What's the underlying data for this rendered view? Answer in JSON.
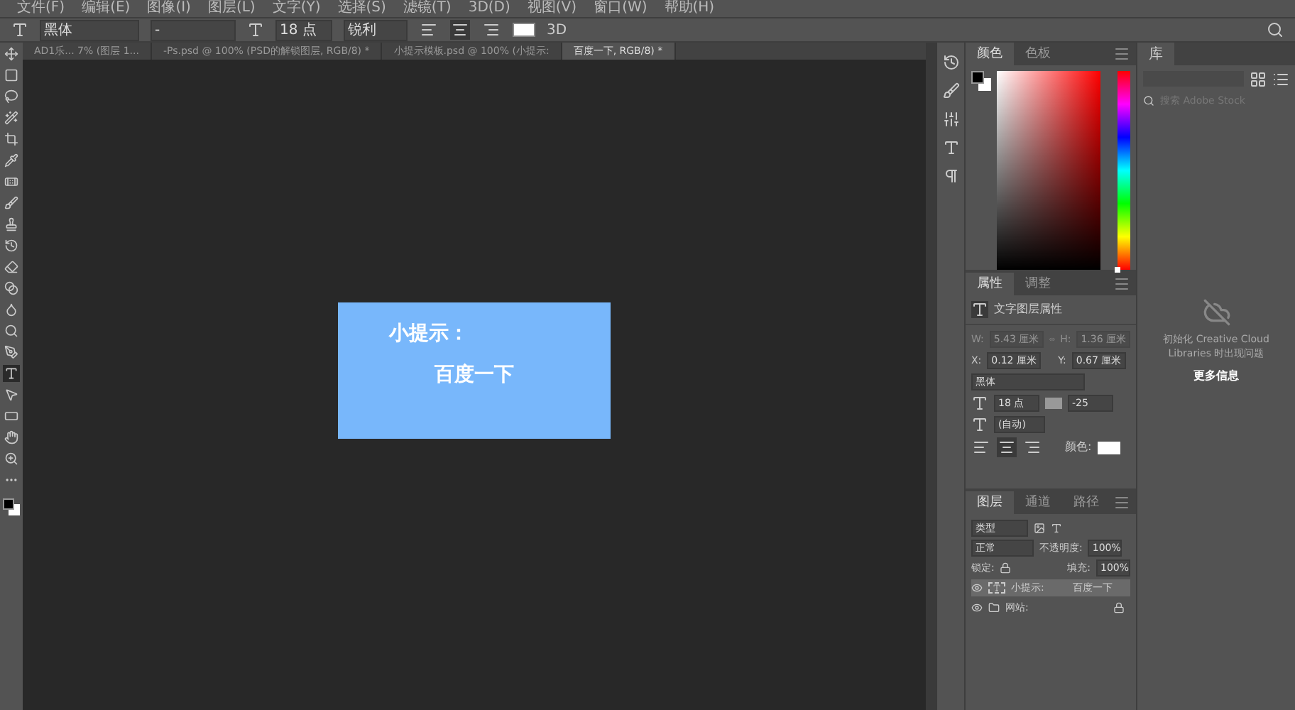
{
  "menu": [
    "文件(F)",
    "编辑(E)",
    "图像(I)",
    "图层(L)",
    "文字(Y)",
    "选择(S)",
    "滤镜(T)",
    "3D(D)",
    "视图(V)",
    "窗口(W)",
    "帮助(H)"
  ],
  "options_bar": {
    "font_family": "黑体",
    "font_style": "-",
    "font_size": "18 点",
    "antialias": "锐利",
    "align": [
      {
        "selected": false
      },
      {
        "selected": true
      },
      {
        "selected": false
      }
    ],
    "threed": "3D"
  },
  "tabs": [
    {
      "label": "AD1乐... 7% (图层 1...",
      "selected": false
    },
    {
      "label": "-Ps.psd @ 100% (PSD的解锁图层, RGB/8) *",
      "selected": false
    },
    {
      "label": "小提示模板.psd @ 100% (小提示:",
      "selected": false
    },
    {
      "label": "百度一下, RGB/8) *",
      "selected": true
    }
  ],
  "tools": [
    {
      "kind": "move",
      "selected": false
    },
    {
      "kind": "marquee",
      "selected": false
    },
    {
      "kind": "lasso",
      "selected": false
    },
    {
      "kind": "wand",
      "selected": false
    },
    {
      "kind": "crop",
      "selected": false
    },
    {
      "kind": "eyedropper",
      "selected": false
    },
    {
      "kind": "heal",
      "selected": false
    },
    {
      "kind": "brush",
      "selected": false
    },
    {
      "kind": "stamp",
      "selected": false
    },
    {
      "kind": "history",
      "selected": false
    },
    {
      "kind": "eraser",
      "selected": false
    },
    {
      "kind": "gradient",
      "selected": false
    },
    {
      "kind": "blur",
      "selected": false
    },
    {
      "kind": "dodge",
      "selected": false
    },
    {
      "kind": "pen",
      "selected": false
    },
    {
      "kind": "type",
      "selected": true
    },
    {
      "kind": "select",
      "selected": false
    },
    {
      "kind": "rectangle",
      "selected": false
    },
    {
      "kind": "hand",
      "selected": false
    },
    {
      "kind": "zoom",
      "selected": false
    },
    {
      "kind": "more",
      "selected": false
    }
  ],
  "canvas": {
    "title": "小提示：",
    "text": "百度一下"
  },
  "color_panel": {
    "hue_slider": {
      "level": 0
    },
    "tabs": [
      {
        "label": "颜色",
        "selected": true
      },
      {
        "label": "色板",
        "selected": false
      }
    ]
  },
  "properties": {
    "tabs": [
      {
        "label": "属性",
        "selected": true
      },
      {
        "label": "调整",
        "selected": false
      }
    ],
    "header": "文字图层属性",
    "w_label": "W:",
    "w": "5.43 厘米",
    "h_label": "H:",
    "h": "1.36 厘米",
    "x_label": "X:",
    "x": "0.12 厘米",
    "y_label": "Y:",
    "y": "0.67 厘米",
    "font": "黑体",
    "size": "18 点",
    "tracking": "-25",
    "leading": "(自动)",
    "align": [
      {
        "selected": false
      },
      {
        "selected": true
      },
      {
        "selected": false
      }
    ],
    "color_label": "颜色:"
  },
  "layers": {
    "tabs": [
      {
        "label": "图层",
        "selected": true
      },
      {
        "label": "通道",
        "selected": false
      },
      {
        "label": "路径",
        "selected": false
      }
    ],
    "filter": "类型",
    "blend": "正常",
    "opacity_label": "不透明度:",
    "opacity": "100%",
    "lock_label": "锁定:",
    "fill_label": "填充:",
    "fill": "100%",
    "items": [
      {
        "kind": "text",
        "name": "小提示:",
        "extra": "百度一下",
        "visible": true,
        "selected": true,
        "locked": false
      },
      {
        "kind": "group",
        "name": "网站:",
        "visible": true,
        "selected": false,
        "locked": true
      }
    ]
  },
  "libraries": {
    "tab": "库",
    "search_placeholder": "搜索 Adobe Stock",
    "message": "初始化 Creative Cloud Libraries 时出现问题",
    "link": "更多信息"
  }
}
